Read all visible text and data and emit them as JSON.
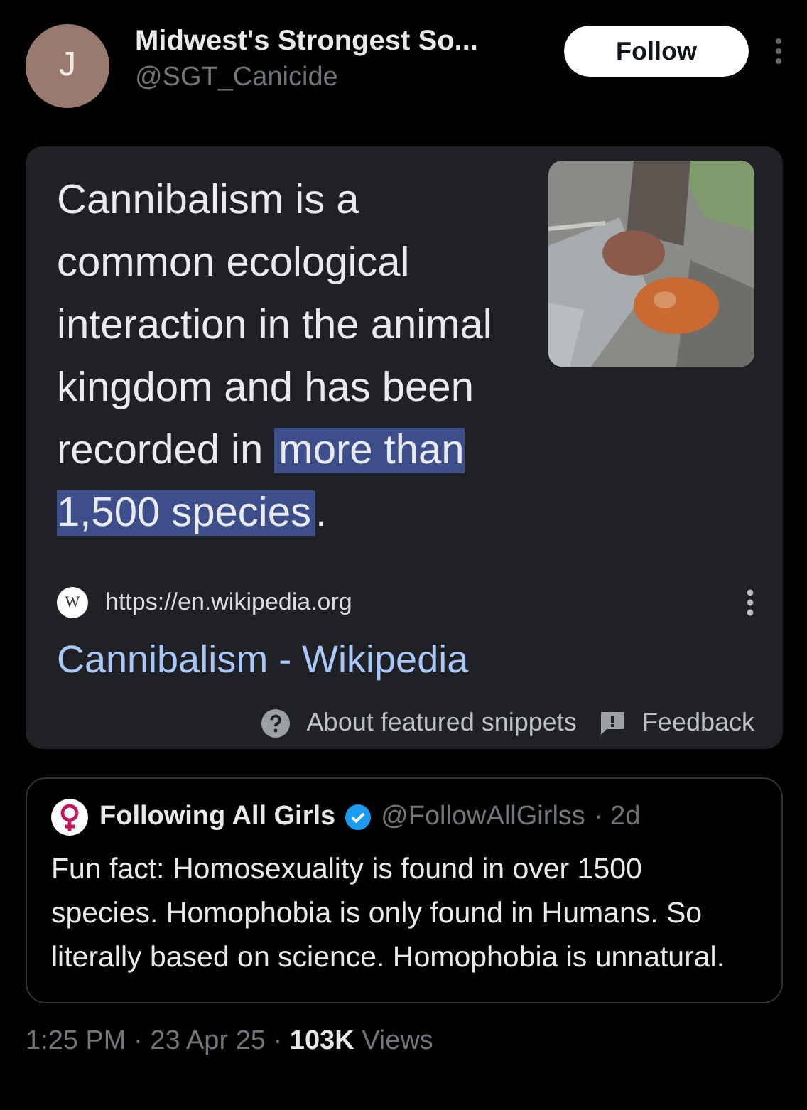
{
  "author": {
    "initial": "J",
    "name": "Midwest's Strongest So...",
    "handle": "@SGT_Canicide"
  },
  "follow_button": "Follow",
  "snippet": {
    "text_before": "Cannibalism is a common ecological interaction in the animal kingdom and has been recorded in ",
    "highlight": "more than 1,500 species",
    "text_after": ".",
    "source_icon": "W",
    "url": "https://en.wikipedia.org",
    "title": "Cannibalism - Wikipedia",
    "about": "About featured snippets",
    "feedback": "Feedback"
  },
  "quoted_tweet": {
    "name": "Following All Girls",
    "verified": true,
    "handle": "@FollowAllGirlss",
    "time": "· 2d",
    "text": "Fun fact: Homosexuality is found in over 1500 species. Homophobia is only found in Humans. So literally based on science. Homophobia is unnatural."
  },
  "meta": "1:25 PM · 23 Apr 25 · **103K** Views"
}
